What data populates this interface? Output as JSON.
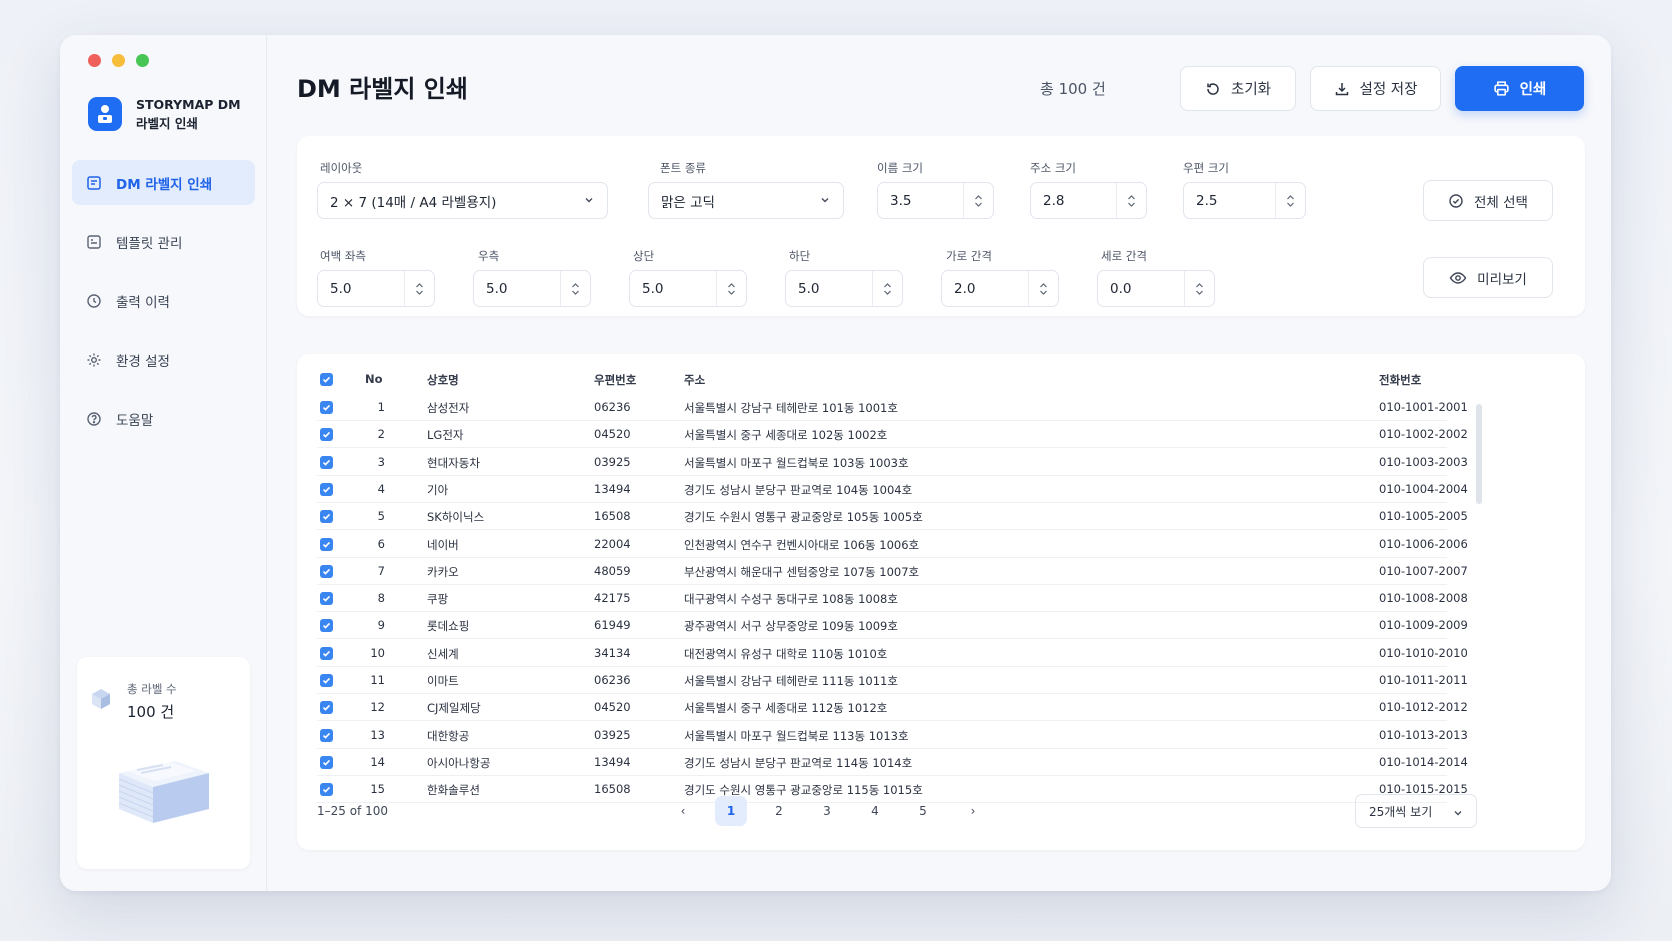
{
  "sidebar": {
    "brand_line1": "STORYMAP DM",
    "brand_line2": "라벨지 인쇄",
    "items": [
      {
        "label": "DM 라벨지 인쇄",
        "icon": "label-print-icon",
        "active": true
      },
      {
        "label": "템플릿 관리",
        "icon": "template-icon",
        "active": false
      },
      {
        "label": "출력 이력",
        "icon": "history-clock-icon",
        "active": false
      },
      {
        "label": "환경 설정",
        "icon": "gear-icon",
        "active": false
      },
      {
        "label": "도움말",
        "icon": "help-icon",
        "active": false
      }
    ],
    "stat_label": "총 라벨 수",
    "stat_value": "100 건"
  },
  "header": {
    "title": "DM 라벨지 인쇄",
    "total": "총 100 건",
    "reset_label": "초기화",
    "save_label": "설정 저장",
    "print_label": "인쇄"
  },
  "settings": {
    "layout_label": "레이아웃",
    "layout_value": "2 × 7 (14매 / A4 라벨용지)",
    "font_label": "폰트 종류",
    "font_value": "맑은 고딕",
    "name_size_label": "이름 크기",
    "name_size": "3.5",
    "addr_size_label": "주소 크기",
    "addr_size": "2.8",
    "zip_size_label": "우편 크기",
    "zip_size": "2.5",
    "margin_left_label": "여백 좌측",
    "margin_left": "5.0",
    "margin_right_label": "우측",
    "margin_right": "5.0",
    "margin_top_label": "상단",
    "margin_top": "5.0",
    "margin_bottom_label": "하단",
    "margin_bottom": "5.0",
    "gap_h_label": "가로 간격",
    "gap_h": "2.0",
    "gap_v_label": "세로 간격",
    "gap_v": "0.0",
    "select_all_label": "전체 선택",
    "preview_label": "미리보기"
  },
  "table": {
    "columns": {
      "no": "No",
      "name": "상호명",
      "zip": "우편번호",
      "address": "주소",
      "phone": "전화번호"
    },
    "rows": [
      {
        "no": "1",
        "name": "삼성전자",
        "zip": "06236",
        "address": "서울특별시 강남구 테헤란로 101동 1001호",
        "phone": "010-1001-2001"
      },
      {
        "no": "2",
        "name": "LG전자",
        "zip": "04520",
        "address": "서울특별시 중구 세종대로 102동 1002호",
        "phone": "010-1002-2002"
      },
      {
        "no": "3",
        "name": "현대자동차",
        "zip": "03925",
        "address": "서울특별시 마포구 월드컵북로 103동 1003호",
        "phone": "010-1003-2003"
      },
      {
        "no": "4",
        "name": "기아",
        "zip": "13494",
        "address": "경기도 성남시 분당구 판교역로 104동 1004호",
        "phone": "010-1004-2004"
      },
      {
        "no": "5",
        "name": "SK하이닉스",
        "zip": "16508",
        "address": "경기도 수원시 영통구 광교중앙로 105동 1005호",
        "phone": "010-1005-2005"
      },
      {
        "no": "6",
        "name": "네이버",
        "zip": "22004",
        "address": "인천광역시 연수구 컨벤시아대로 106동 1006호",
        "phone": "010-1006-2006"
      },
      {
        "no": "7",
        "name": "카카오",
        "zip": "48059",
        "address": "부산광역시 해운대구 센텀중앙로 107동 1007호",
        "phone": "010-1007-2007"
      },
      {
        "no": "8",
        "name": "쿠팡",
        "zip": "42175",
        "address": "대구광역시 수성구 동대구로 108동 1008호",
        "phone": "010-1008-2008"
      },
      {
        "no": "9",
        "name": "롯데쇼핑",
        "zip": "61949",
        "address": "광주광역시 서구 상무중앙로 109동 1009호",
        "phone": "010-1009-2009"
      },
      {
        "no": "10",
        "name": "신세계",
        "zip": "34134",
        "address": "대전광역시 유성구 대학로 110동 1010호",
        "phone": "010-1010-2010"
      },
      {
        "no": "11",
        "name": "이마트",
        "zip": "06236",
        "address": "서울특별시 강남구 테헤란로 111동 1011호",
        "phone": "010-1011-2011"
      },
      {
        "no": "12",
        "name": "CJ제일제당",
        "zip": "04520",
        "address": "서울특별시 중구 세종대로 112동 1012호",
        "phone": "010-1012-2012"
      },
      {
        "no": "13",
        "name": "대한항공",
        "zip": "03925",
        "address": "서울특별시 마포구 월드컵북로 113동 1013호",
        "phone": "010-1013-2013"
      },
      {
        "no": "14",
        "name": "아시아나항공",
        "zip": "13494",
        "address": "경기도 성남시 분당구 판교역로 114동 1014호",
        "phone": "010-1014-2014"
      },
      {
        "no": "15",
        "name": "한화솔루션",
        "zip": "16508",
        "address": "경기도 수원시 영통구 광교중앙로 115동 1015호",
        "phone": "010-1015-2015"
      }
    ]
  },
  "pagination": {
    "info": "1–25 of 100",
    "pages": [
      "1",
      "2",
      "3",
      "4",
      "5"
    ],
    "current": "1",
    "prev": "‹",
    "next": "›",
    "per_page": "25개씩 보기"
  },
  "colors": {
    "accent": "#1e6df2",
    "active_bg": "#e3ecfc"
  }
}
